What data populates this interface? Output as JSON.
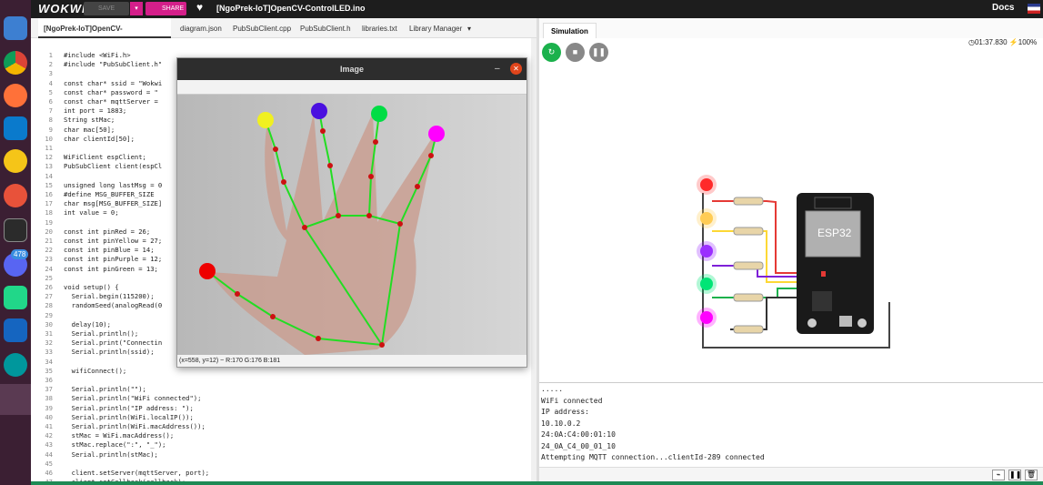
{
  "header": {
    "logo": "WOKWI",
    "save_label": "SAVE",
    "share_label": "SHARE",
    "project_title": "[NgoPrek-IoT]OpenCV-ControlLED.ino",
    "docs_label": "Docs"
  },
  "editor_tabs": [
    "[NgoPrek-IoT]OpenCV-ControlLED.ino",
    "diagram.json",
    "PubSubClient.cpp",
    "PubSubClient.h",
    "libraries.txt",
    "Library Manager"
  ],
  "code_lines": [
    {
      "n": "1",
      "t": "#include <WiFi.h>"
    },
    {
      "n": "2",
      "t": "#include \"PubSubClient.h\""
    },
    {
      "n": "3",
      "t": ""
    },
    {
      "n": "4",
      "t": "const char* ssid = \"Wokwi"
    },
    {
      "n": "5",
      "t": "const char* password = \""
    },
    {
      "n": "6",
      "t": "const char* mqttServer ="
    },
    {
      "n": "7",
      "t": "int port = 1883;"
    },
    {
      "n": "8",
      "t": "String stMac;"
    },
    {
      "n": "9",
      "t": "char mac[50];"
    },
    {
      "n": "10",
      "t": "char clientId[50];"
    },
    {
      "n": "11",
      "t": ""
    },
    {
      "n": "12",
      "t": "WiFiClient espClient;"
    },
    {
      "n": "13",
      "t": "PubSubClient client(espCl"
    },
    {
      "n": "14",
      "t": ""
    },
    {
      "n": "15",
      "t": "unsigned long lastMsg = 0"
    },
    {
      "n": "16",
      "t": "#define MSG_BUFFER_SIZE"
    },
    {
      "n": "17",
      "t": "char msg[MSG_BUFFER_SIZE]"
    },
    {
      "n": "18",
      "t": "int value = 0;"
    },
    {
      "n": "19",
      "t": ""
    },
    {
      "n": "20",
      "t": "const int pinRed = 26;"
    },
    {
      "n": "21",
      "t": "const int pinYellow = 27;"
    },
    {
      "n": "22",
      "t": "const int pinBlue = 14;"
    },
    {
      "n": "23",
      "t": "const int pinPurple = 12;"
    },
    {
      "n": "24",
      "t": "const int pinGreen = 13;"
    },
    {
      "n": "25",
      "t": ""
    },
    {
      "n": "26",
      "t": "void setup() {"
    },
    {
      "n": "27",
      "t": "  Serial.begin(115200);"
    },
    {
      "n": "28",
      "t": "  randomSeed(analogRead(0"
    },
    {
      "n": "29",
      "t": ""
    },
    {
      "n": "30",
      "t": "  delay(10);"
    },
    {
      "n": "31",
      "t": "  Serial.println();"
    },
    {
      "n": "32",
      "t": "  Serial.print(\"Connectin"
    },
    {
      "n": "33",
      "t": "  Serial.println(ssid);"
    },
    {
      "n": "34",
      "t": ""
    },
    {
      "n": "35",
      "t": "  wifiConnect();"
    },
    {
      "n": "36",
      "t": ""
    },
    {
      "n": "37",
      "t": "  Serial.println(\"\");"
    },
    {
      "n": "38",
      "t": "  Serial.println(\"WiFi connected\");"
    },
    {
      "n": "39",
      "t": "  Serial.println(\"IP address: \");"
    },
    {
      "n": "40",
      "t": "  Serial.println(WiFi.localIP());"
    },
    {
      "n": "41",
      "t": "  Serial.println(WiFi.macAddress());"
    },
    {
      "n": "42",
      "t": "  stMac = WiFi.macAddress();"
    },
    {
      "n": "43",
      "t": "  stMac.replace(\":\", \"_\");"
    },
    {
      "n": "44",
      "t": "  Serial.println(stMac);"
    },
    {
      "n": "45",
      "t": ""
    },
    {
      "n": "46",
      "t": "  client.setServer(mqttServer, port);"
    },
    {
      "n": "47",
      "t": "  client.setCallback(callback);"
    }
  ],
  "cv_window": {
    "title": "Image",
    "status": "(x=558, y=12) ~ R:170 G:176 B:181"
  },
  "simulation": {
    "tab_label": "Simulation",
    "timer": "01:37.830",
    "speed": "100%",
    "chip_label": "ESP32"
  },
  "serial_lines": [
    ".....",
    "WiFi connected",
    "IP address:",
    "10.10.0.2",
    "24:0A:C4:00:01:10",
    "24_0A_C4_00_01_10",
    "Attempting MQTT connection...clientId-289 connected"
  ],
  "dock": {
    "badge": "478"
  },
  "colors": {
    "wokwi_pink": "#d41f8a",
    "led_red": "#ff2a2a",
    "led_yellow": "#ffcc55",
    "led_purple": "#9b30ff",
    "led_green": "#00e676",
    "led_magenta": "#ff00ff"
  }
}
